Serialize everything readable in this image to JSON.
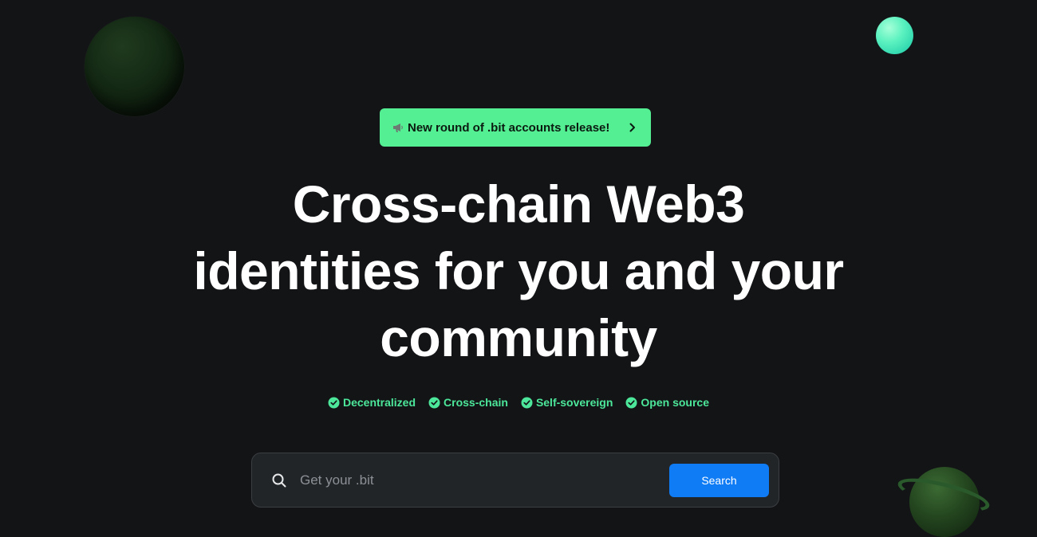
{
  "announcement": {
    "label": "New round of .bit accounts release!",
    "icon": "megaphone-icon",
    "action_icon": "chevron-right-icon",
    "bg_color": "#54ef93"
  },
  "hero": {
    "title_lines": [
      "Cross-chain Web3",
      "identities for you and your",
      "community"
    ]
  },
  "features": [
    {
      "label": "Decentralized",
      "icon": "check-circle-icon"
    },
    {
      "label": "Cross-chain",
      "icon": "check-circle-icon"
    },
    {
      "label": "Self-sovereign",
      "icon": "check-circle-icon"
    },
    {
      "label": "Open source",
      "icon": "check-circle-icon"
    }
  ],
  "search": {
    "placeholder": "Get your .bit",
    "value": "",
    "button_label": "Search",
    "button_color": "#0f7cf6"
  },
  "colors": {
    "background": "#131416",
    "accent_green": "#4ce79a"
  }
}
